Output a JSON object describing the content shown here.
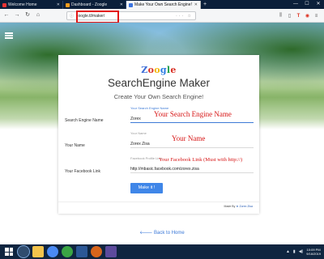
{
  "browser": {
    "tabs": [
      {
        "label": "Welcome Home",
        "active": false
      },
      {
        "label": "Dashboard - Zoogle",
        "active": false
      },
      {
        "label": "Make Your Own Search Engine!",
        "active": true
      }
    ],
    "new_tab": "+",
    "url": "zoogle.tl/maker/"
  },
  "logo": {
    "z": "Z",
    "o1": "o",
    "o2": "o",
    "g": "g",
    "l": "l",
    "e": "e"
  },
  "card": {
    "title": "SearchEngine Maker",
    "subtitle": "Create Your Own Search Engine!",
    "fields": [
      {
        "label": "Search Engine Name",
        "caption": "Your Search Engine Name",
        "value": "Zorex",
        "annotation": "Your Search Engine Name"
      },
      {
        "label": "Your Name",
        "caption": "Your Name",
        "value": "Zorex Zisa",
        "annotation": "Your Name"
      },
      {
        "label": "Your Facebook Link",
        "caption": "Facebook Profile Link",
        "value": "http://mbasic.facebook.com/zorex.zisa",
        "annotation": "Your Facebook Link (Must with http://)"
      }
    ],
    "submit": "Make it !",
    "credit_prefix": "Made By",
    "credit_name": "Zorex Zisa"
  },
  "back_link": "Back to Home",
  "taskbar": {
    "time": "10:09 PM",
    "date": "9/16/2019"
  },
  "colors": {
    "accent": "#3f86e8",
    "annotation": "#d71515",
    "highlight": "#e31515"
  }
}
